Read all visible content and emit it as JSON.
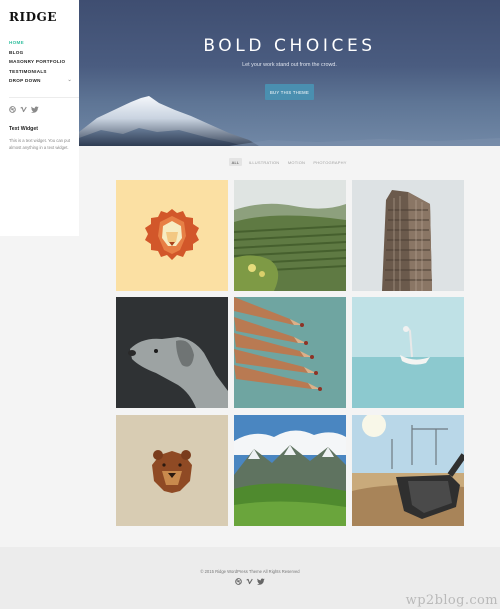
{
  "brand": {
    "logo": "RIDGE"
  },
  "sidebar": {
    "nav": [
      {
        "label": "HOME",
        "active": true
      },
      {
        "label": "BLOG"
      },
      {
        "label": "MASONRY PORTFOLIO"
      },
      {
        "label": "TESTIMONIALS"
      },
      {
        "label": "DROP DOWN",
        "has_dropdown": true
      }
    ],
    "social_icons": [
      "dribbble-icon",
      "vimeo-icon",
      "twitter-icon"
    ],
    "widget": {
      "title": "Text Widget",
      "text": "This is a text widget. You can put almost anything in a text widget."
    }
  },
  "hero": {
    "title": "BOLD CHOICES",
    "subtitle": "Let your work stand out from the crowd.",
    "button": "BUY THIS THEME"
  },
  "filters": [
    {
      "label": "ALL",
      "active": true
    },
    {
      "label": "ILLUSTRATION"
    },
    {
      "label": "MOTION"
    },
    {
      "label": "PHOTOGRAPHY"
    }
  ],
  "portfolio": [
    {
      "subject": "lion-illustration"
    },
    {
      "subject": "tea-hills-photo"
    },
    {
      "subject": "flatiron-building-photo"
    },
    {
      "subject": "dog-photo"
    },
    {
      "subject": "colored-pencils-photo"
    },
    {
      "subject": "boat-photo"
    },
    {
      "subject": "bear-illustration"
    },
    {
      "subject": "mountain-valley-photo"
    },
    {
      "subject": "excavator-photo"
    }
  ],
  "footer": {
    "copyright": "© 2015 Ridge WordPress Theme All Rights Reserved",
    "social_icons": [
      "dribbble-icon",
      "vimeo-icon",
      "twitter-icon"
    ]
  },
  "watermark": "wp2blog.com",
  "colors": {
    "accent": "#35c0a0",
    "button": "#4a8fb0",
    "hero": "#4a5c80"
  }
}
